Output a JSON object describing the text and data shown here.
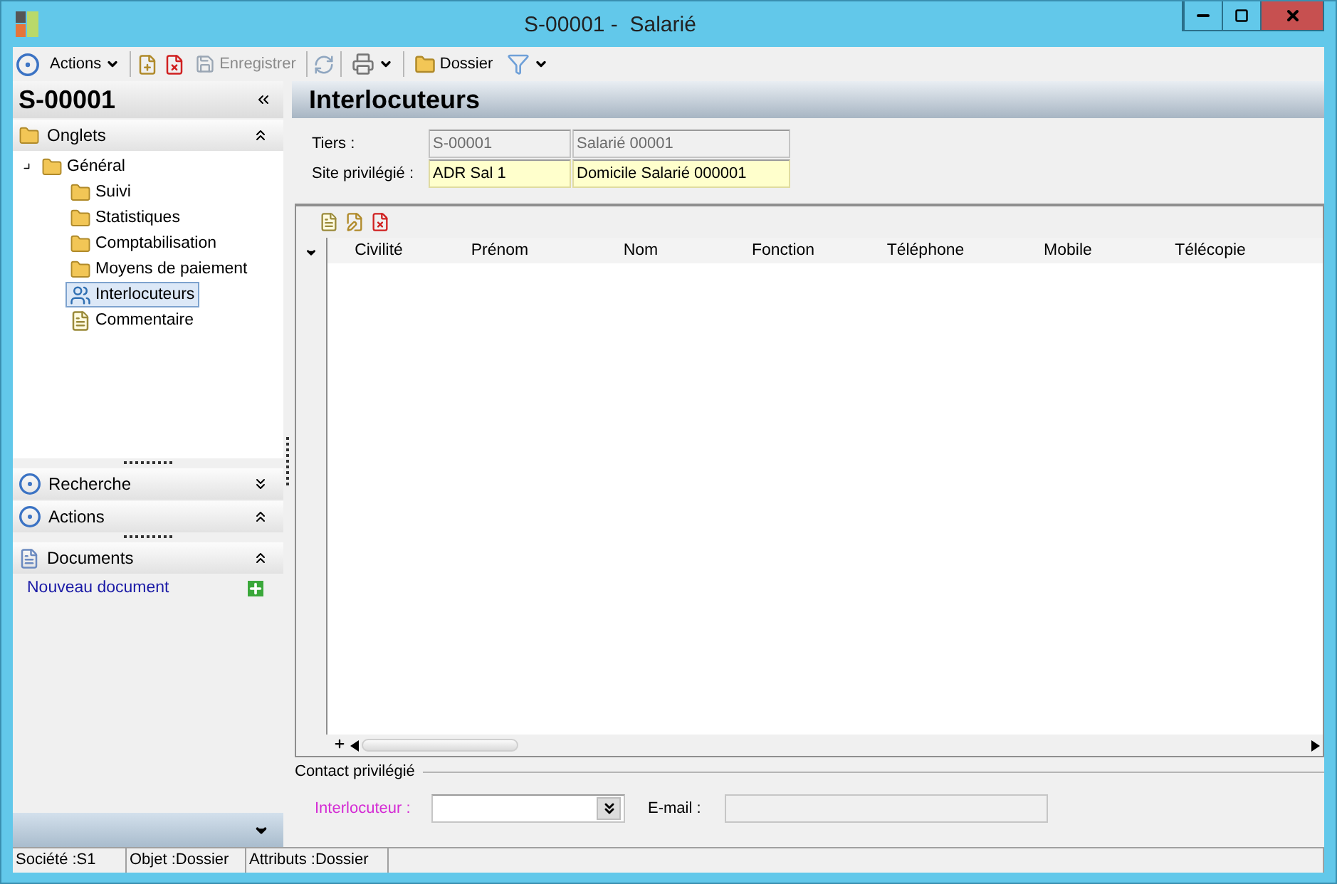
{
  "window": {
    "title": "S-00001 -  Salarié"
  },
  "toolbar": {
    "actions_label": "Actions",
    "save": {
      "label": "Enregistrer",
      "disabled": true
    },
    "folder_label": "Dossier"
  },
  "left_panel": {
    "title": "S-00001",
    "sections": [
      {
        "kind": "tree",
        "label": "Onglets",
        "expanded": true,
        "items": [
          {
            "label": "Général",
            "kind": "folder",
            "selected": false,
            "expanded": true,
            "children": [
              {
                "label": "Suivi",
                "kind": "folder",
                "selected": false
              },
              {
                "label": "Statistiques",
                "kind": "folder",
                "selected": false
              },
              {
                "label": "Comptabilisation",
                "kind": "folder",
                "selected": false
              },
              {
                "label": "Moyens de paiement",
                "kind": "folder",
                "selected": false
              },
              {
                "label": "Interlocuteurs",
                "kind": "contacts",
                "selected": true
              },
              {
                "label": "Commentaire",
                "kind": "note",
                "selected": false
              }
            ]
          }
        ]
      },
      {
        "kind": "search",
        "label": "Recherche",
        "expanded": false
      },
      {
        "kind": "actions",
        "label": "Actions",
        "expanded": true
      },
      {
        "kind": "documents",
        "label": "Documents",
        "expanded": true,
        "links": [
          "Nouveau document"
        ]
      }
    ]
  },
  "content": {
    "title": "Interlocuteurs",
    "fields": [
      {
        "label": "Tiers :",
        "kind": "readonly",
        "values": [
          "S-00001",
          "Salarié 00001"
        ]
      },
      {
        "label": "Site privilégié :",
        "kind": "required",
        "values": [
          "ADR Sal 1",
          "Domicile Salarié 000001"
        ]
      }
    ],
    "grid": {
      "columns": [
        "Civilité",
        "Prénom",
        "Nom",
        "Fonction",
        "Téléphone",
        "Mobile",
        "Télécopie"
      ]
    },
    "contact": {
      "legend": "Contact privilégié",
      "contact_label": "Interlocuteur :",
      "email_label": "E-mail :"
    }
  },
  "status_bar": [
    "Société :S1",
    "Objet :Dossier",
    "Attributs :Dossier"
  ]
}
